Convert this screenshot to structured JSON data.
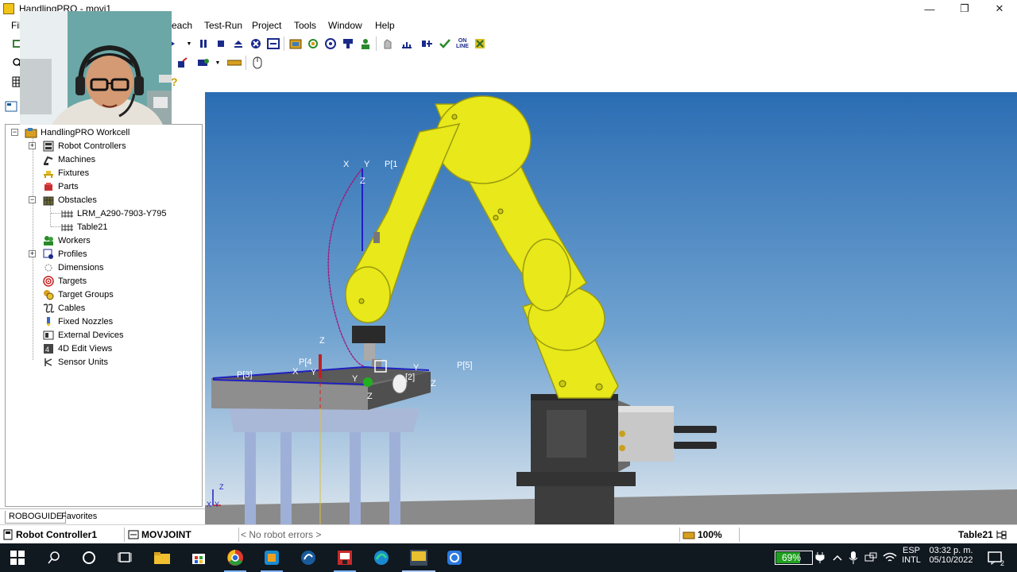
{
  "window": {
    "app_title": "HandlingPRO - movi1",
    "minimize_glyph": "—",
    "restore_glyph": "❐",
    "close_glyph": "✕"
  },
  "menu": {
    "file": "Fil",
    "teach": "each",
    "test_run": "Test-Run",
    "project": "Project",
    "tools": "Tools",
    "window": "Window",
    "help": "Help"
  },
  "toolbar": {
    "online_top": "ON",
    "online_bottom": "LINE"
  },
  "tree": {
    "root": "HandlingPRO Workcell",
    "items": [
      {
        "label": "Robot Controllers",
        "icon": "controller-icon"
      },
      {
        "label": "Machines",
        "icon": "machine-icon"
      },
      {
        "label": "Fixtures",
        "icon": "fixture-icon"
      },
      {
        "label": "Parts",
        "icon": "part-icon"
      },
      {
        "label": "Obstacles",
        "icon": "obstacle-icon"
      },
      {
        "label": "LRM_A290-7903-Y795",
        "icon": "obstacle-item-icon"
      },
      {
        "label": "Table21",
        "icon": "obstacle-item-icon"
      },
      {
        "label": "Workers",
        "icon": "worker-icon"
      },
      {
        "label": "Profiles",
        "icon": "profile-icon"
      },
      {
        "label": "Dimensions",
        "icon": "dimension-icon"
      },
      {
        "label": "Targets",
        "icon": "target-icon"
      },
      {
        "label": "Target Groups",
        "icon": "target-group-icon"
      },
      {
        "label": "Cables",
        "icon": "cable-icon"
      },
      {
        "label": "Fixed Nozzles",
        "icon": "nozzle-icon"
      },
      {
        "label": "External Devices",
        "icon": "external-device-icon"
      },
      {
        "label": "4D Edit Views",
        "icon": "edit-view-icon"
      },
      {
        "label": "Sensor Units",
        "icon": "sensor-icon"
      }
    ]
  },
  "tabs": {
    "roboguide": "ROBOGUIDE",
    "favorites": "Favorites"
  },
  "viewport": {
    "labels": {
      "p1": "P[1",
      "p3": "P[3]",
      "p4": "P[4",
      "p2": "[2]",
      "p5": "P[5]",
      "x": "X",
      "y": "Y",
      "z": "Z"
    },
    "colors": {
      "sky_top": "#2b6db3",
      "sky_bottom": "#dde6ee",
      "robot_yellow": "#e8e81a",
      "floor": "#8a8a8a"
    }
  },
  "status": {
    "controller": "Robot Controller1",
    "motion": "MOVJOINT",
    "errors": "< No robot errors >",
    "zoom": "100%",
    "selection": "Table21"
  },
  "taskbar": {
    "battery": "69%",
    "lang_top": "ESP",
    "lang_bottom": "INTL",
    "time": "03:32 p. m.",
    "date": "05/10/2022",
    "notifications": "2"
  }
}
